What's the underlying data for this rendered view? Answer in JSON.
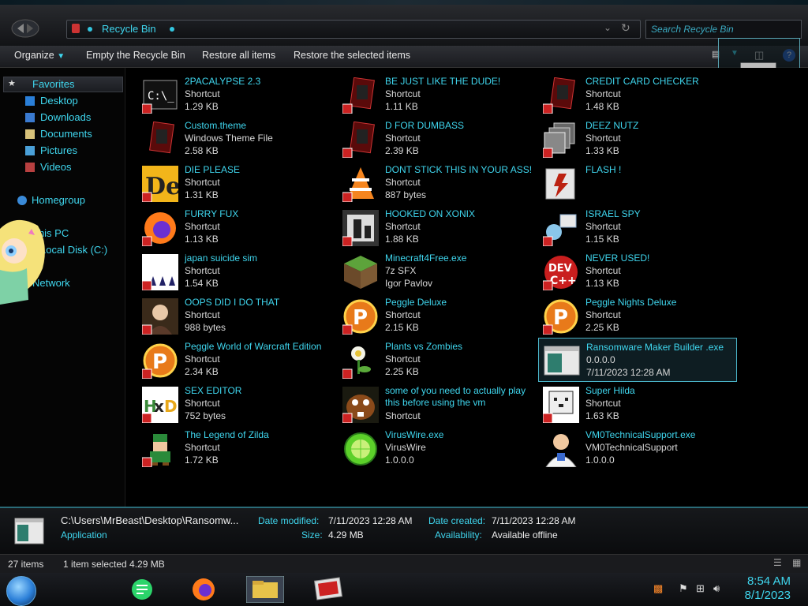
{
  "window": {
    "address": {
      "location": "Recycle Bin"
    },
    "search": {
      "placeholder": "Search Recycle Bin"
    }
  },
  "toolbar": {
    "organize": "Organize",
    "empty": "Empty the Recycle Bin",
    "restore_all": "Restore all items",
    "restore_selected": "Restore the selected items"
  },
  "sidebar": {
    "favorites": "Favorites",
    "desktop": "Desktop",
    "downloads": "Downloads",
    "documents": "Documents",
    "pictures": "Pictures",
    "videos": "Videos",
    "homegroup": "Homegroup",
    "thispc": "This PC",
    "localdisk": "Local Disk (C:)",
    "network": "Network"
  },
  "files": [
    {
      "name": "2PACALYPSE 2.3",
      "type": "Shortcut",
      "info": "1.29 KB",
      "icon": "cmd-icon"
    },
    {
      "name": "BE JUST LIKE THE DUDE!",
      "type": "Shortcut",
      "info": "1.11 KB",
      "icon": "red-card-icon"
    },
    {
      "name": "CREDIT CARD CHECKER",
      "type": "Shortcut",
      "info": "1.48 KB",
      "icon": "red-card-icon"
    },
    {
      "name": "Custom.theme",
      "type": "Windows Theme File",
      "info": "2.58 KB",
      "icon": "theme-icon"
    },
    {
      "name": "D FOR DUMBASS",
      "type": "Shortcut",
      "info": "2.39 KB",
      "icon": "red-card-icon"
    },
    {
      "name": "DEEZ NUTZ",
      "type": "Shortcut",
      "info": "1.33 KB",
      "icon": "stacked-windows-icon"
    },
    {
      "name": "DIE PLEASE",
      "type": "Shortcut",
      "info": "1.31 KB",
      "icon": "de-icon"
    },
    {
      "name": "DONT STICK THIS IN YOUR ASS!",
      "type": "Shortcut",
      "info": "887 bytes",
      "icon": "vlc-cone-icon"
    },
    {
      "name": "FLASH !",
      "type": "",
      "info": "",
      "icon": "flash-icon"
    },
    {
      "name": "FURRY FUX",
      "type": "Shortcut",
      "info": "1.13 KB",
      "icon": "firefox-icon"
    },
    {
      "name": "HOOKED ON XONIX",
      "type": "Shortcut",
      "info": "1.88 KB",
      "icon": "xonix-icon"
    },
    {
      "name": "ISRAEL SPY",
      "type": "Shortcut",
      "info": "1.15 KB",
      "icon": "network-spy-icon"
    },
    {
      "name": "japan suicide sim",
      "type": "Shortcut",
      "info": "1.54 KB",
      "icon": "japan-sim-icon"
    },
    {
      "name": "Minecraft4Free.exe",
      "type": "7z SFX",
      "info": "Igor Pavlov",
      "icon": "minecraft-block-icon"
    },
    {
      "name": "NEVER USED!",
      "type": "Shortcut",
      "info": "1.13 KB",
      "icon": "dev-cpp-icon"
    },
    {
      "name": "OOPS DID I DO THAT",
      "type": "Shortcut",
      "info": "988 bytes",
      "icon": "portrait-icon"
    },
    {
      "name": "Peggle Deluxe",
      "type": "Shortcut",
      "info": "2.15 KB",
      "icon": "peggle-icon"
    },
    {
      "name": "Peggle Nights Deluxe",
      "type": "Shortcut",
      "info": "2.25 KB",
      "icon": "peggle-icon"
    },
    {
      "name": "Peggle World of Warcraft Edition",
      "type": "Shortcut",
      "info": "2.34 KB",
      "icon": "peggle-icon"
    },
    {
      "name": "Plants vs Zombies",
      "type": "Shortcut",
      "info": "2.25 KB",
      "icon": "plant-icon"
    },
    {
      "name": "Ransomware Maker Builder .exe",
      "type": "0.0.0.0",
      "info": "7/11/2023 12:28 AM",
      "icon": "app-window-icon"
    },
    {
      "name": "SEX EDITOR",
      "type": "Shortcut",
      "info": "752 bytes",
      "icon": "hxd-icon"
    },
    {
      "name": "some of you need to actually play this before using the vm",
      "type": "Shortcut",
      "info": "",
      "icon": "beaver-icon"
    },
    {
      "name": "Super Hilda",
      "type": "Shortcut",
      "info": "1.63 KB",
      "icon": "dog-icon"
    },
    {
      "name": "The Legend of Zilda",
      "type": "Shortcut",
      "info": "1.72 KB",
      "icon": "zelda-icon"
    },
    {
      "name": "VirusWire.exe",
      "type": "VirusWire",
      "info": "1.0.0.0",
      "icon": "lime-icon"
    },
    {
      "name": "VM0TechnicalSupport.exe",
      "type": "VM0TechnicalSupport",
      "info": "1.0.0.0",
      "icon": "support-person-icon"
    }
  ],
  "details": {
    "path": "C:\\Users\\MrBeast\\Desktop\\Ransomw...",
    "kind": "Application",
    "modified_label": "Date modified:",
    "modified": "7/11/2023 12:28 AM",
    "size_label": "Size:",
    "size": "4.29 MB",
    "created_label": "Date created:",
    "created": "7/11/2023 12:28 AM",
    "avail_label": "Availability:",
    "avail": "Available offline"
  },
  "status": {
    "count": "27 items",
    "selected": "1 item selected  4.29 MB"
  },
  "taskbar": {
    "time": "8:54 AM",
    "date": "8/1/2023"
  },
  "colors": {
    "accent": "#3fd6ee",
    "background": "#000000"
  }
}
